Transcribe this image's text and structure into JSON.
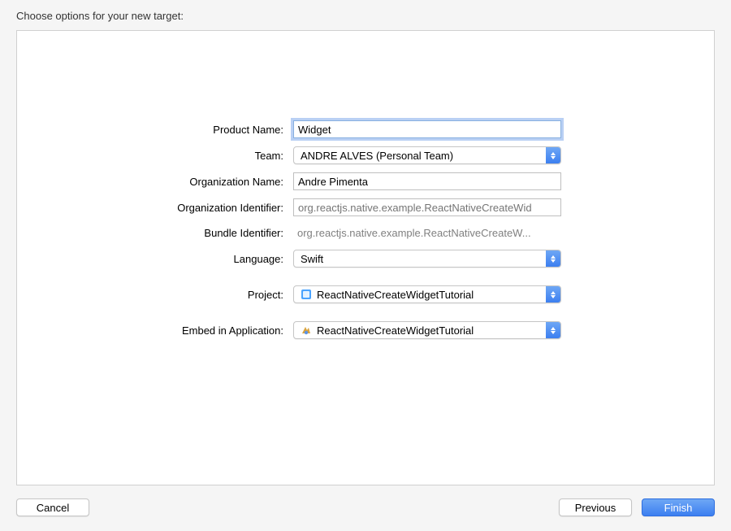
{
  "header": {
    "title": "Choose options for your new target:"
  },
  "form": {
    "product_name": {
      "label": "Product Name:",
      "value": "Widget"
    },
    "team": {
      "label": "Team:",
      "value": "ANDRE ALVES (Personal Team)"
    },
    "org_name": {
      "label": "Organization Name:",
      "value": "Andre Pimenta"
    },
    "org_id": {
      "label": "Organization Identifier:",
      "placeholder": "org.reactjs.native.example.ReactNativeCreateWid"
    },
    "bundle_id": {
      "label": "Bundle Identifier:",
      "value": "org.reactjs.native.example.ReactNativeCreateW..."
    },
    "language": {
      "label": "Language:",
      "value": "Swift"
    },
    "project": {
      "label": "Project:",
      "value": "ReactNativeCreateWidgetTutorial"
    },
    "embed": {
      "label": "Embed in Application:",
      "value": "ReactNativeCreateWidgetTutorial"
    }
  },
  "footer": {
    "cancel": "Cancel",
    "previous": "Previous",
    "finish": "Finish"
  }
}
